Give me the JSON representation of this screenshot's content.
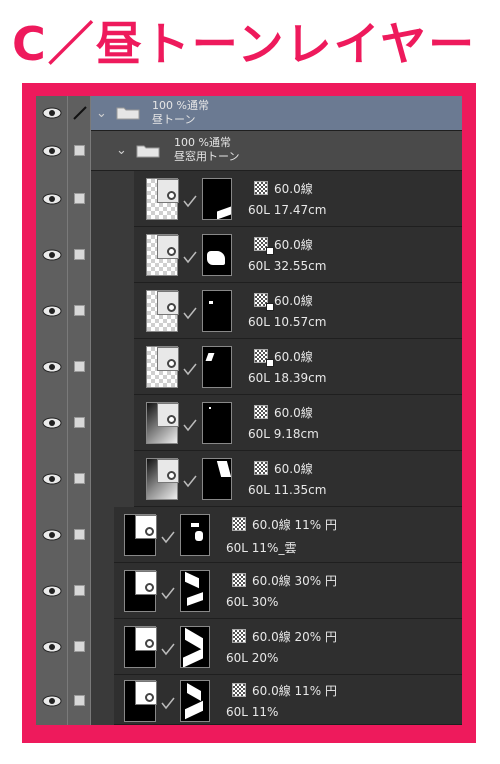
{
  "title": "C／昼トーンレイヤー",
  "folders": [
    {
      "line1": "100 %通常",
      "line2": "昼トーン"
    },
    {
      "line1": "100 %通常",
      "line2": "昼窓用トーン"
    }
  ],
  "layers": [
    {
      "props": "60.0線",
      "name": "60L 17.47cm"
    },
    {
      "props": "60.0線",
      "name": "60L 32.55cm"
    },
    {
      "props": "60.0線",
      "name": "60L 10.57cm"
    },
    {
      "props": "60.0線",
      "name": "60L 18.39cm"
    },
    {
      "props": "60.0線",
      "name": "60L 9.18cm"
    },
    {
      "props": "60.0線",
      "name": "60L 11.35cm"
    },
    {
      "props": "60.0線 11% 円",
      "name": "60L 11%_雲"
    },
    {
      "props": "60.0線 30% 円",
      "name": "60L 30%"
    },
    {
      "props": "60.0線 20% 円",
      "name": "60L 20%"
    },
    {
      "props": "60.0線 11% 円",
      "name": "60L 11%"
    }
  ],
  "icons": {
    "visibility": "eye-icon",
    "lock": "checkbox-icon",
    "edit": "pencil-icon",
    "folder": "folder-icon",
    "link": "link-check-icon",
    "tone": "tone-pattern-icon"
  },
  "colors": {
    "accent": "#ee1a5c",
    "panel": "#3a3a3a",
    "selected_folder": "#6b7a92"
  }
}
